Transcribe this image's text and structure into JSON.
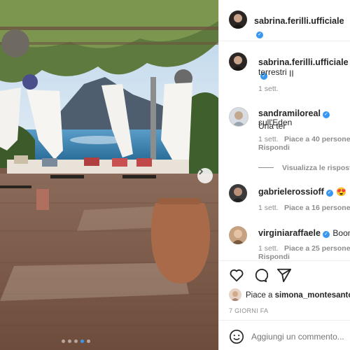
{
  "post": {
    "author": "sabrina.ferilli.ufficiale",
    "caption": "terrestri ꞁꞁ",
    "caption_time": "1 sett."
  },
  "carousel": {
    "dots": 5,
    "active_index": 3
  },
  "comments": [
    {
      "username": "sandramiloreal",
      "text": "Una ter",
      "text_line2": "sull'Eden",
      "time": "1 sett.",
      "likes": "Piace a 40 persone",
      "reply": "Rispondi",
      "view_replies": "Visualizza le risposte ("
    },
    {
      "username": "gabrielerossioff",
      "text": "😍",
      "time": "1 sett.",
      "likes": "Piace a 16 persone"
    },
    {
      "username": "virginiaraffaele",
      "text": "Boom",
      "time": "1 sett.",
      "likes": "Piace a 25 persone",
      "reply": "Rispondi"
    }
  ],
  "actions": {
    "liked_by_prefix": "Piace a",
    "liked_by_user": "simona_montesanto",
    "date": "7 GIORNI FA"
  },
  "comment_input": {
    "placeholder": "Aggiungi un commento..."
  },
  "colors": {
    "verified_blue": "#3897f0",
    "text": "#262626",
    "secondary": "#8e8e8e",
    "border": "#efefef"
  }
}
